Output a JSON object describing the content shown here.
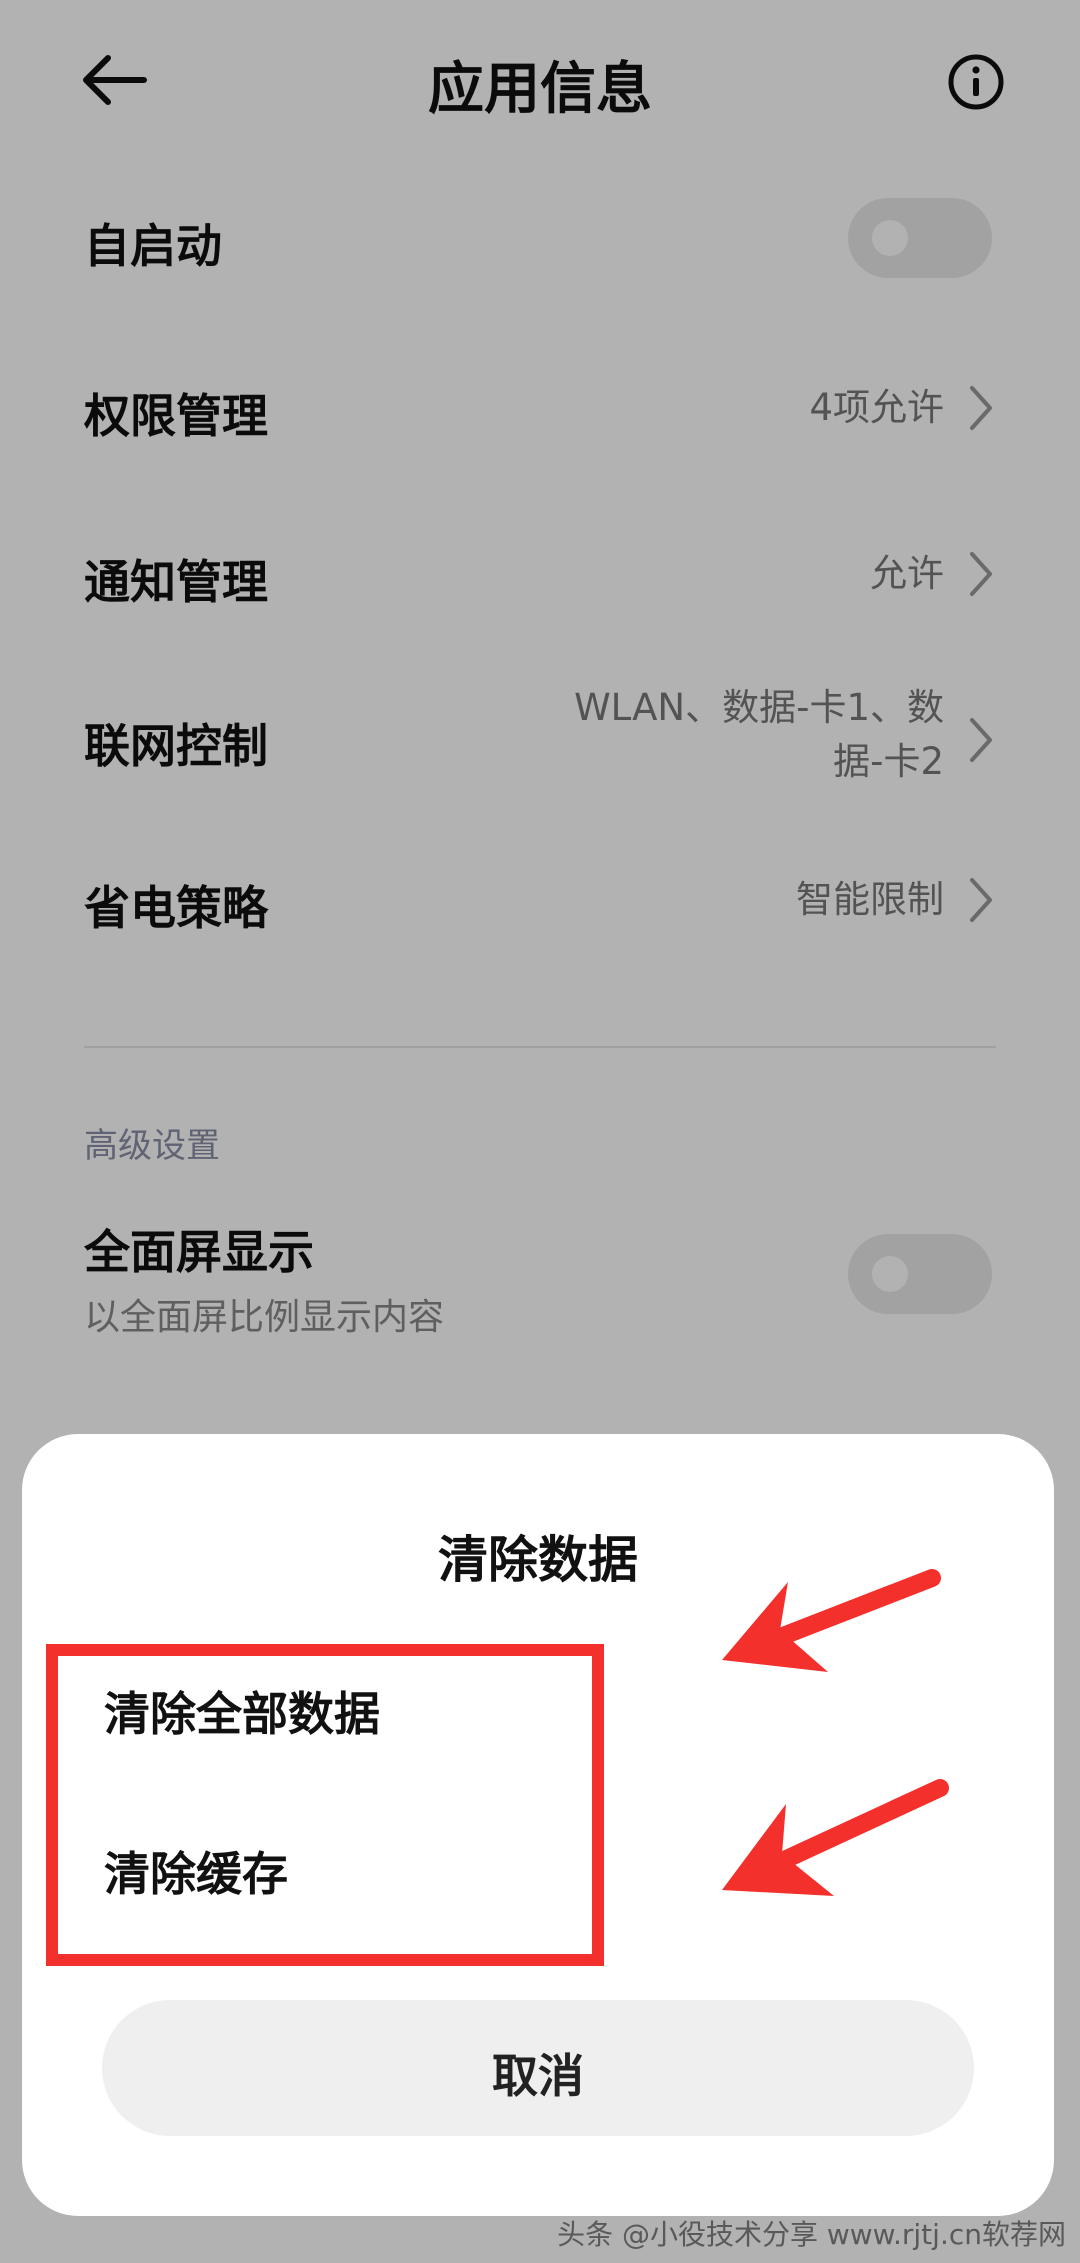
{
  "header": {
    "title": "应用信息",
    "back_icon": "back-arrow-icon",
    "info_icon": "info-icon"
  },
  "settings": {
    "rows": [
      {
        "label": "自启动",
        "type": "toggle",
        "state": "off"
      },
      {
        "label": "权限管理",
        "value": "4项允许"
      },
      {
        "label": "通知管理",
        "value": "允许"
      },
      {
        "label": "联网控制",
        "value_line1": "WLAN、数据-卡1、数",
        "value_line2": "据-卡2"
      },
      {
        "label": "省电策略",
        "value": "智能限制"
      }
    ]
  },
  "advanced": {
    "section_title": "高级设置",
    "fullscreen": {
      "label": "全面屏显示",
      "subtitle": "以全面屏比例显示内容",
      "state": "off"
    }
  },
  "dialog": {
    "title": "清除数据",
    "options": [
      "清除全部数据",
      "清除缓存"
    ],
    "cancel_label": "取消"
  },
  "colors": {
    "annotation": "#f3302b",
    "dim_overlay": "rgba(0,0,0,0.30)"
  },
  "watermark": "头条 @小役技术分享  www.rjtj.cn软荐网"
}
